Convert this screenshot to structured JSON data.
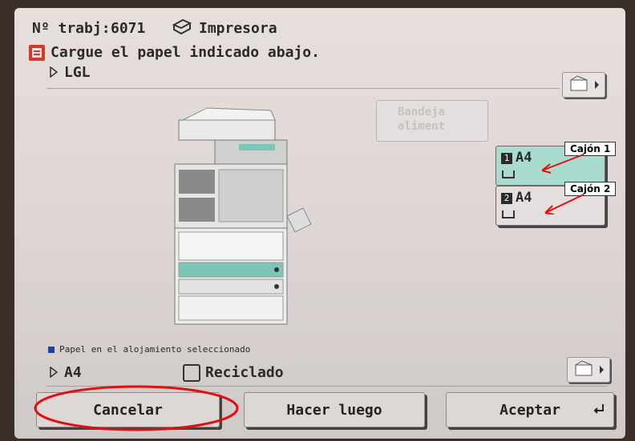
{
  "header": {
    "job_label": "Nº trabj:",
    "job_number": "6071",
    "mode_label": "Impresora"
  },
  "message": "Cargue el papel indicado abajo.",
  "original_size": "LGL",
  "bypass": {
    "line1": "Bandeja",
    "line2": "aliment"
  },
  "drawers": [
    {
      "number": "1",
      "size": "A4",
      "selected": true
    },
    {
      "number": "2",
      "size": "A4",
      "selected": false
    }
  ],
  "annotations": {
    "drawer1": "Cajón 1",
    "drawer2": "Cajón 2"
  },
  "selected_note": "Papel en el alojamiento seleccionado",
  "paper": {
    "size": "A4",
    "type": "Reciclado"
  },
  "buttons": {
    "cancel": "Cancelar",
    "later": "Hacer luego",
    "accept": "Aceptar"
  },
  "colors": {
    "accent": "#a9dccf",
    "warning": "#d33a2f",
    "selected_indicator": "#1f3fa8",
    "annotation": "#e01010"
  },
  "icons": [
    "printer-icon",
    "warning-icon",
    "settings-icon",
    "recycle-icon",
    "enter-icon"
  ]
}
